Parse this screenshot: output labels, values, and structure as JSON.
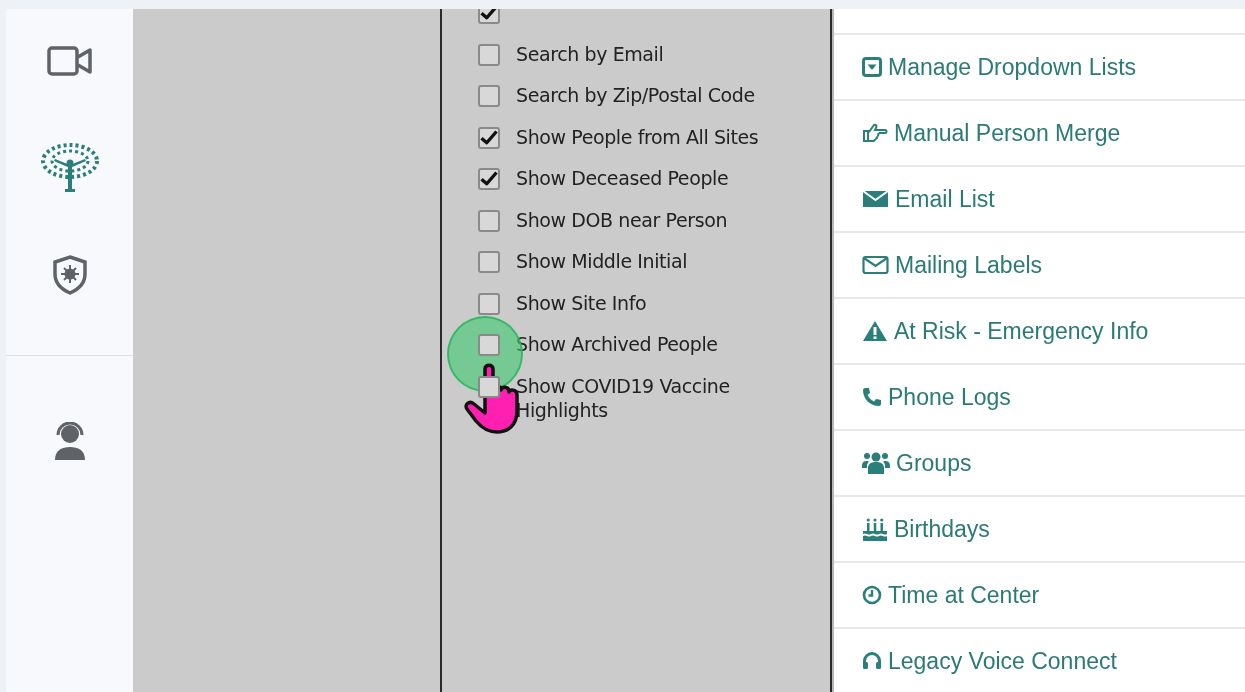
{
  "options": [
    {
      "checked": true
    },
    {
      "label": "Search by Email",
      "checked": false
    },
    {
      "label": "Search by Zip/Postal Code",
      "checked": false
    },
    {
      "label": "Show People from All Sites",
      "checked": true
    },
    {
      "label": "Show Deceased People",
      "checked": true
    },
    {
      "label": "Show DOB near Person",
      "checked": false
    },
    {
      "label": "Show Middle Initial",
      "checked": false
    },
    {
      "label": "Show Site Info",
      "checked": false
    },
    {
      "label": "Show Archived People",
      "checked": false
    },
    {
      "label": "Show COVID19 Vaccine Highlights",
      "checked": false
    }
  ],
  "menu": [
    {
      "label": "Manage Dropdown Lists"
    },
    {
      "label": "Manual Person Merge"
    },
    {
      "label": "Email List"
    },
    {
      "label": "Mailing Labels"
    },
    {
      "label": "At Risk - Emergency Info"
    },
    {
      "label": "Phone Logs"
    },
    {
      "label": "Groups"
    },
    {
      "label": "Birthdays"
    },
    {
      "label": "Time at Center"
    },
    {
      "label": "Legacy Voice Connect"
    }
  ]
}
